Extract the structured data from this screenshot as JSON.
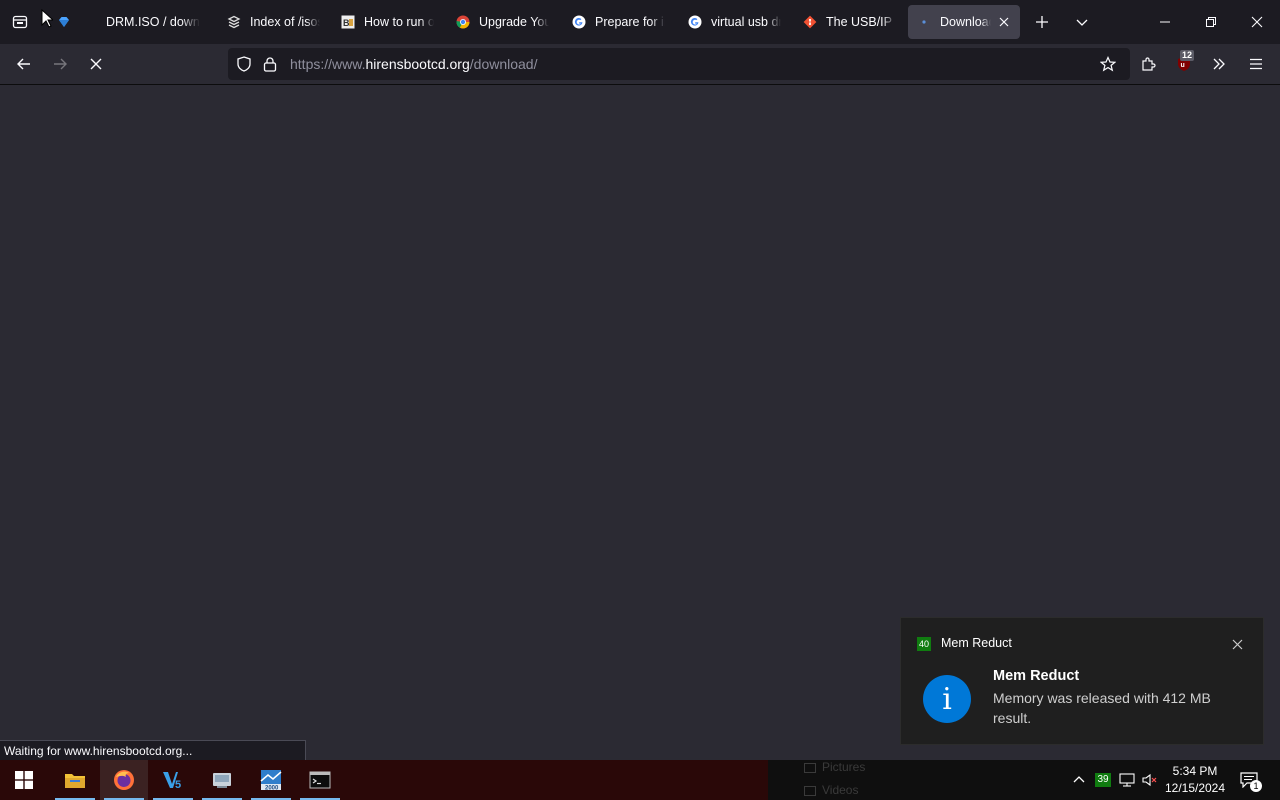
{
  "browser": {
    "tabs": [
      {
        "title": "",
        "favicon": "gem-icon",
        "color": "#4aa3ff"
      },
      {
        "title": "DRM.ISO / downl",
        "favicon": "none"
      },
      {
        "title": "Index of /isos",
        "favicon": "stack-icon"
      },
      {
        "title": "How to run o",
        "favicon": "tutorial-icon"
      },
      {
        "title": "Upgrade You",
        "favicon": "chrome-icon"
      },
      {
        "title": "Prepare for in",
        "favicon": "google-icon"
      },
      {
        "title": "virtual usb dr",
        "favicon": "google-icon"
      },
      {
        "title": "The USB/IP P",
        "favicon": "git-icon",
        "color": "#f05133"
      },
      {
        "title": "Download",
        "favicon": "loading-dot-icon",
        "active": true
      }
    ],
    "url_prefix": "https://www.",
    "url_host": "hirensbootcd.org",
    "url_path": "/download/",
    "extension_badge": "12",
    "status_text": "Waiting for www.hirensbootcd.org..."
  },
  "notification": {
    "app_badge": "40",
    "app_name": "Mem Reduct",
    "title": "Mem Reduct",
    "body": "Memory was released with 412 MB result."
  },
  "taskbar": {
    "ghost_items": [
      "Pictures",
      "Videos"
    ],
    "tray_badge": "39",
    "time": "5:34 PM",
    "date": "12/15/2024",
    "action_center_count": "1"
  }
}
